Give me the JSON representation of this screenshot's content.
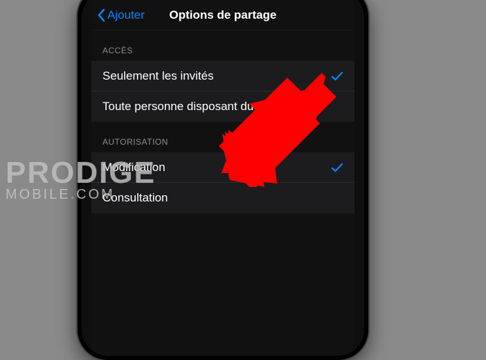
{
  "nav": {
    "back_label": "Ajouter",
    "title": "Options de partage"
  },
  "sections": {
    "access": {
      "header": "ACCÈS",
      "items": [
        {
          "label": "Seulement les invités",
          "selected": true
        },
        {
          "label": "Toute personne disposant du lien",
          "selected": false
        }
      ]
    },
    "auth": {
      "header": "AUTORISATION",
      "items": [
        {
          "label": "Modification",
          "selected": true
        },
        {
          "label": "Consultation",
          "selected": false
        }
      ]
    }
  },
  "watermark": {
    "line1": "PRODIGE",
    "line2": "MOBILE.COM"
  },
  "colors": {
    "accent": "#0a84ff",
    "arrow": "#ff0000"
  }
}
